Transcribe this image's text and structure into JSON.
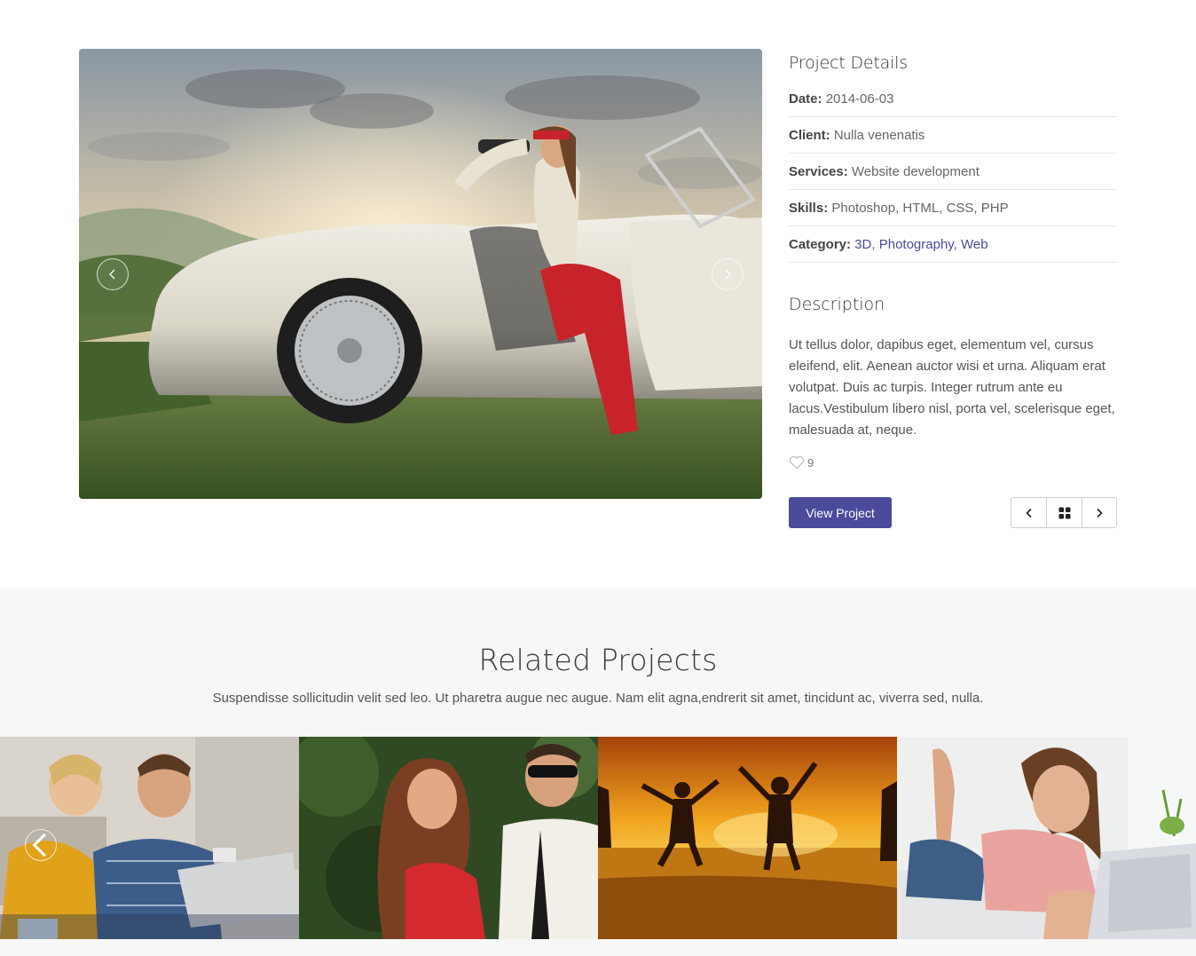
{
  "project": {
    "image_alt": "Woman with binoculars sitting in a vintage white convertible",
    "details_title": "Project Details",
    "rows": [
      {
        "label": "Date:",
        "value": "2014-06-03"
      },
      {
        "label": "Client:",
        "value": "Nulla venenatis"
      },
      {
        "label": "Services:",
        "value": "Website development"
      },
      {
        "label": "Skills:",
        "value": "Photoshop, HTML, CSS, PHP"
      }
    ],
    "category_label": "Category:",
    "categories": [
      "3D",
      "Photography",
      "Web"
    ],
    "category_separator": ", ",
    "description_title": "Description",
    "description": "Ut tellus dolor, dapibus eget, elementum vel, cursus eleifend, elit. Aenean auctor wisi et urna. Aliquam erat volutpat. Duis ac turpis. Integer rutrum ante eu lacus.Vestibulum libero nisl, porta vel, scelerisque eget, malesuada at, neque.",
    "likes": "9",
    "view_button": "View Project"
  },
  "related": {
    "title": "Related Projects",
    "subtitle": "Suspendisse sollicitudin velit sed leo. Ut pharetra augue nec augue. Nam elit agna,endrerit sit amet, tincidunt ac, viverra sed, nulla.",
    "thumbs": [
      {
        "name": "couple-laptop"
      },
      {
        "name": "fashion-couple"
      },
      {
        "name": "beach-jump"
      },
      {
        "name": "woman-laptop"
      }
    ]
  },
  "colors": {
    "accent": "#4c4a9b",
    "link": "#4a4aa0",
    "related_bg": "#f6f7f6"
  }
}
